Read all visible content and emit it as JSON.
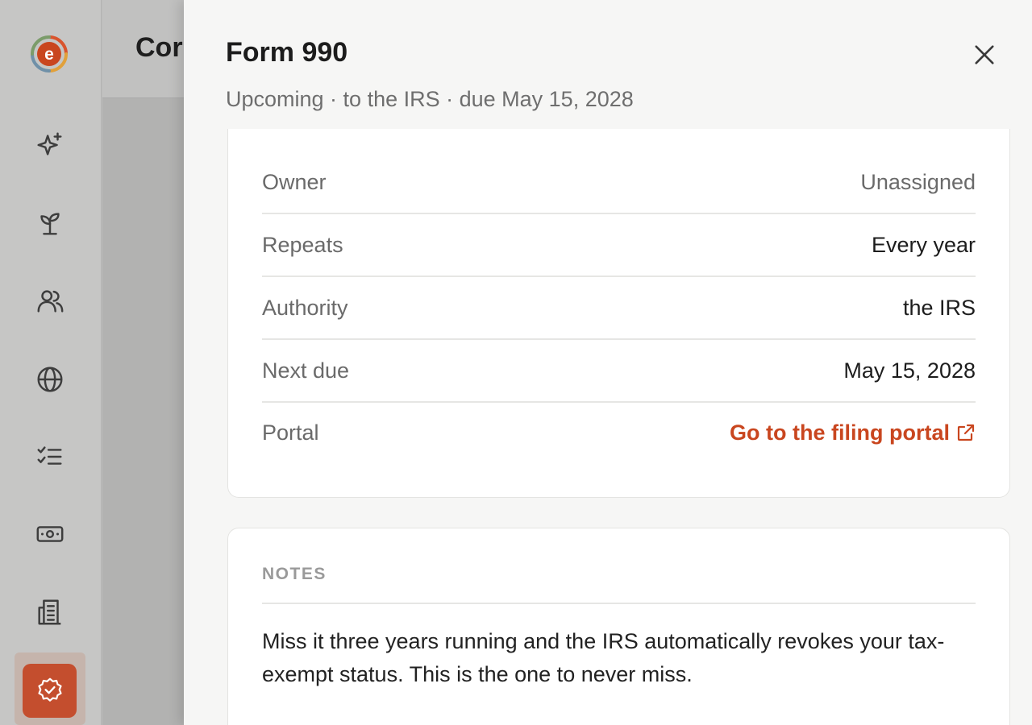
{
  "background_page": {
    "title_partial": "Cor"
  },
  "sidebar": {
    "logo_icon": "edeal-logo-icon",
    "items": [
      {
        "icon": "sparkles-icon"
      },
      {
        "icon": "sprout-icon"
      },
      {
        "icon": "users-icon"
      },
      {
        "icon": "globe-icon"
      },
      {
        "icon": "checklist-icon"
      },
      {
        "icon": "money-icon"
      },
      {
        "icon": "building-icon"
      },
      {
        "icon": "badge-check-icon",
        "active": true
      }
    ],
    "active_color": "#c44e2e"
  },
  "drawer": {
    "title": "Form 990",
    "subtitle": "Upcoming · to the IRS · due May 15, 2028",
    "details": [
      {
        "label": "Owner",
        "value": "Unassigned"
      },
      {
        "label": "Repeats",
        "value": "Every year"
      },
      {
        "label": "Authority",
        "value": "the IRS"
      },
      {
        "label": "Next due",
        "value": "May 15, 2028"
      }
    ],
    "portal": {
      "label": "Portal",
      "link_text": "Go to the filing portal"
    },
    "notes": {
      "heading": "NOTES",
      "body": "Miss it three years running and the IRS automatically revokes your tax-exempt status. This is the one to never miss."
    },
    "accent_color": "#c9461f"
  }
}
